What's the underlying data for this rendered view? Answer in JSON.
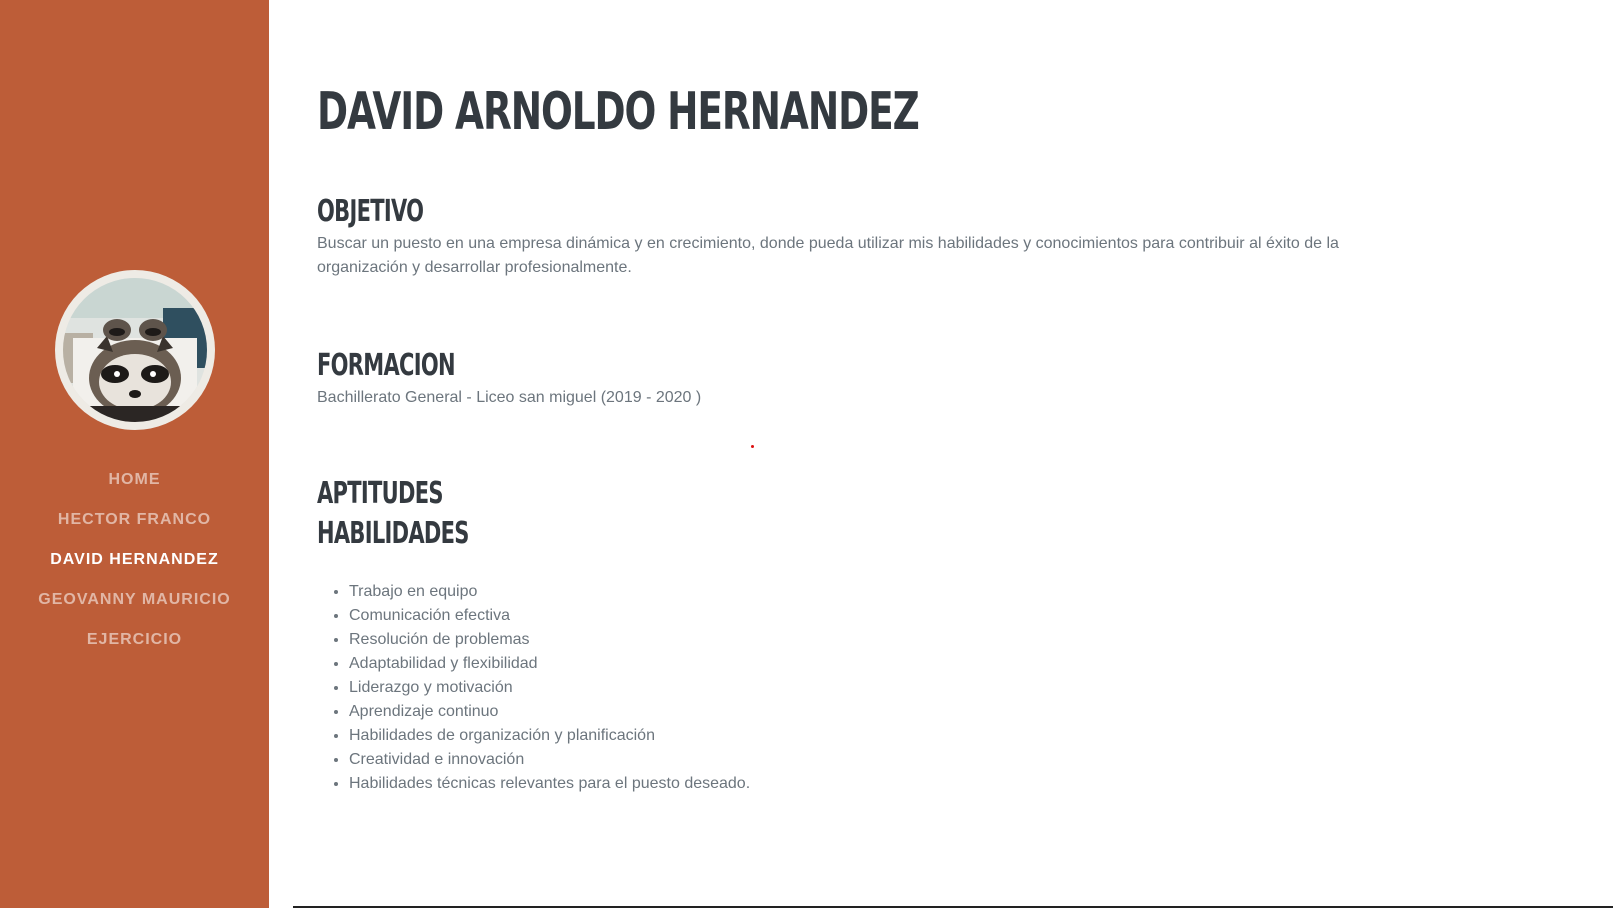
{
  "sidebar": {
    "avatar_alt": "",
    "nav": [
      {
        "label": "HOME",
        "active": false
      },
      {
        "label": "HECTOR FRANCO",
        "active": false
      },
      {
        "label": "DAVID HERNANDEZ",
        "active": true
      },
      {
        "label": "GEOVANNY MAURICIO",
        "active": false
      },
      {
        "label": "EJERCICIO",
        "active": false
      }
    ]
  },
  "main": {
    "name": "DAVID ARNOLDO HERNANDEZ",
    "objetivo": {
      "title": "OBJETIVO",
      "text": "Buscar un puesto en una empresa dinámica y en crecimiento, donde pueda utilizar mis habilidades y conocimientos para contribuir al éxito de la organización y desarrollar profesionalmente."
    },
    "formacion": {
      "title": "FORMACION",
      "text": "Bachillerato General - Liceo san miguel (2019 - 2020 )"
    },
    "aptitudes": {
      "title": "APTITUDES",
      "subtitle": "HABILIDADES",
      "items": [
        "Trabajo en equipo",
        "Comunicación efectiva",
        "Resolución de problemas",
        "Adaptabilidad y flexibilidad",
        "Liderazgo y motivación",
        "Aprendizaje continuo",
        "Habilidades de organización y planificación",
        "Creatividad e innovación",
        "Habilidades técnicas relevantes para el puesto deseado."
      ]
    }
  },
  "colors": {
    "sidebar_bg": "#bd5d38",
    "heading": "#343a40",
    "body_text": "#6c757d"
  }
}
